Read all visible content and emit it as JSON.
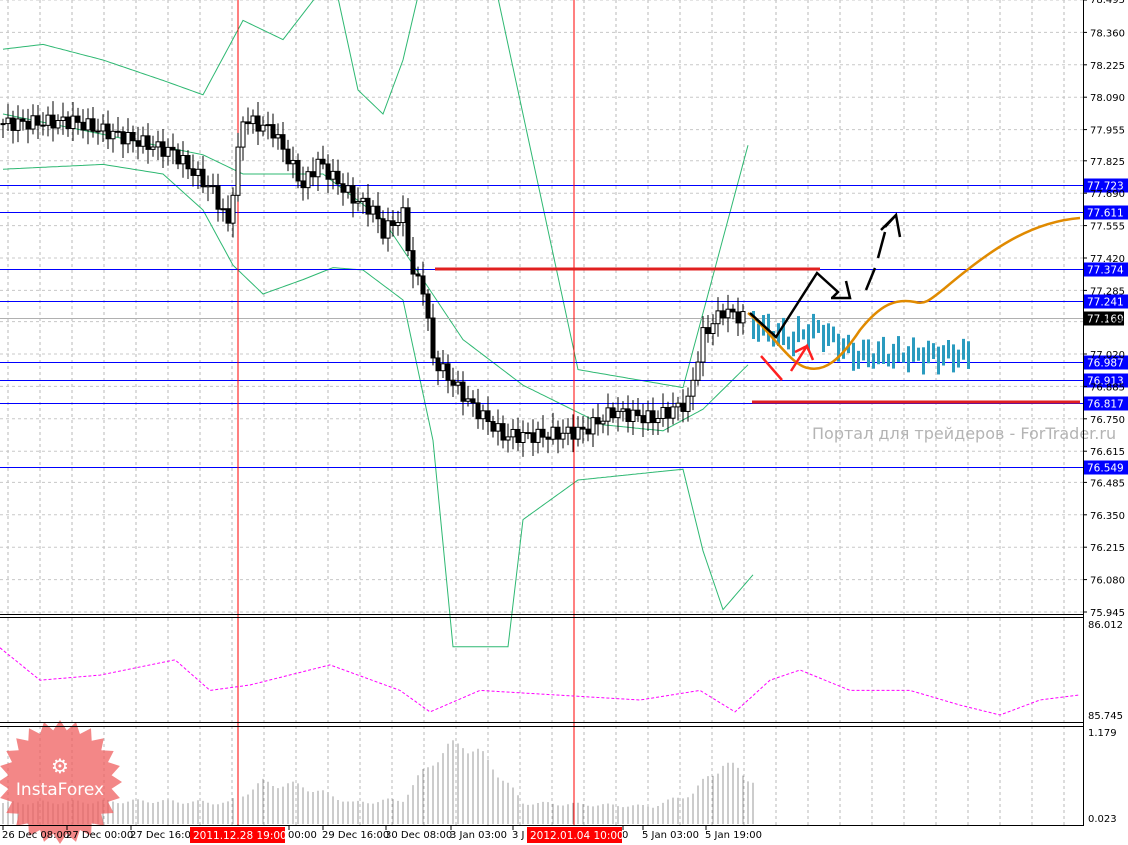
{
  "chart_data": {
    "type": "candlestick",
    "title": "",
    "price_axis": {
      "min": 75.945,
      "max": 78.495,
      "ticks": [
        "78.495",
        "78.360",
        "78.225",
        "78.090",
        "77.955",
        "77.825",
        "77.690",
        "77.555",
        "77.420",
        "77.285",
        "77.155",
        "77.020",
        "76.885",
        "76.750",
        "76.615",
        "76.485",
        "76.350",
        "76.215",
        "76.080",
        "75.945"
      ]
    },
    "time_labels": [
      "26 Dec 08:00",
      "27 Dec 00:00",
      "27 Dec 16:00",
      "00:00",
      "29 Dec 16:00",
      "30 Dec 08:00",
      "3 Jan 03:00",
      "3 J",
      "0",
      "5 Jan 03:00",
      "5 Jan 19:00"
    ],
    "highlighted_times": [
      "2011.12.28 19:00",
      "2012.01.04 10:00"
    ],
    "close_keypoints": [
      [
        0,
        77.98
      ],
      [
        14,
        77.99
      ],
      [
        34,
        77.86
      ],
      [
        42,
        77.7
      ],
      [
        45,
        77.56
      ],
      [
        48,
        78.0
      ],
      [
        54,
        77.95
      ],
      [
        60,
        77.72
      ],
      [
        63,
        77.82
      ],
      [
        70,
        77.67
      ],
      [
        74,
        77.62
      ],
      [
        76,
        77.53
      ],
      [
        80,
        77.6
      ],
      [
        82,
        77.35
      ],
      [
        84,
        77.3
      ],
      [
        86,
        77.0
      ],
      [
        88,
        76.95
      ],
      [
        94,
        76.8
      ],
      [
        100,
        76.68
      ],
      [
        108,
        76.68
      ],
      [
        116,
        76.7
      ],
      [
        122,
        76.78
      ],
      [
        130,
        76.75
      ],
      [
        137,
        76.82
      ],
      [
        140,
        77.1
      ],
      [
        144,
        77.2
      ],
      [
        148,
        77.17
      ]
    ],
    "bollinger": {
      "upper": [
        [
          0,
          78.29
        ],
        [
          8,
          78.31
        ],
        [
          20,
          78.245
        ],
        [
          32,
          78.16
        ],
        [
          40,
          78.1
        ],
        [
          48,
          78.41
        ],
        [
          56,
          78.33
        ],
        [
          66,
          78.6
        ],
        [
          71,
          78.12
        ],
        [
          76,
          78.02
        ],
        [
          80,
          78.245
        ],
        [
          84,
          78.6
        ],
        [
          98,
          78.6
        ],
        [
          115,
          76.955
        ],
        [
          136,
          76.88
        ],
        [
          149,
          77.89
        ]
      ],
      "middle": [
        [
          0,
          78.02
        ],
        [
          40,
          77.85
        ],
        [
          48,
          77.77
        ],
        [
          64,
          77.77
        ],
        [
          76,
          77.58
        ],
        [
          84,
          77.33
        ],
        [
          92,
          77.08
        ],
        [
          104,
          76.89
        ],
        [
          120,
          76.725
        ],
        [
          132,
          76.7
        ],
        [
          140,
          76.79
        ],
        [
          149,
          76.975
        ]
      ],
      "lower": [
        [
          0,
          77.79
        ],
        [
          20,
          77.81
        ],
        [
          32,
          77.77
        ],
        [
          40,
          77.62
        ],
        [
          46,
          77.39
        ],
        [
          52,
          77.27
        ],
        [
          60,
          77.33
        ],
        [
          66,
          77.38
        ],
        [
          72,
          77.37
        ],
        [
          80,
          77.245
        ],
        [
          86,
          76.66
        ],
        [
          90,
          75.8
        ],
        [
          101,
          75.8
        ],
        [
          104,
          76.33
        ],
        [
          115,
          76.495
        ],
        [
          136,
          76.54
        ],
        [
          140,
          76.2
        ],
        [
          144,
          75.955
        ],
        [
          150,
          76.1
        ]
      ]
    },
    "levels": [
      {
        "label": "77.723",
        "price": 77.723,
        "color": "#0000ff"
      },
      {
        "label": "77.611",
        "price": 77.611,
        "color": "#0000ff"
      },
      {
        "label": "77.374",
        "price": 77.374,
        "color": "#0000ff"
      },
      {
        "label": "77.241",
        "price": 77.241,
        "color": "#0000ff"
      },
      {
        "label": "76.987",
        "price": 76.987,
        "color": "#0000ff"
      },
      {
        "label": "76.913",
        "price": 76.913,
        "color": "#0000ff"
      },
      {
        "label": "76.817",
        "price": 76.817,
        "color": "#0000ff"
      },
      {
        "label": "76.549",
        "price": 76.549,
        "color": "#0000ff"
      }
    ],
    "current_price": {
      "label": "77.169",
      "price": 77.169
    },
    "oscillator": {
      "min": 85.745,
      "max": 86.012,
      "labels": [
        "86.012",
        "85.745"
      ],
      "color": "#ff00ff",
      "points": [
        [
          0,
          85.945
        ],
        [
          8,
          85.85
        ],
        [
          20,
          85.865
        ],
        [
          35,
          85.91
        ],
        [
          42,
          85.82
        ],
        [
          50,
          85.836
        ],
        [
          66,
          85.895
        ],
        [
          80,
          85.82
        ],
        [
          86,
          85.757
        ],
        [
          96,
          85.82
        ],
        [
          128,
          85.792
        ],
        [
          140,
          85.82
        ],
        [
          147,
          85.757
        ],
        [
          154,
          85.85
        ],
        [
          160,
          85.88
        ],
        [
          170,
          85.82
        ],
        [
          182,
          85.82
        ],
        [
          192,
          85.777
        ],
        [
          200,
          85.748
        ],
        [
          208,
          85.792
        ],
        [
          216,
          85.807
        ]
      ]
    },
    "volume": {
      "min": 0.023,
      "max": 1.179,
      "labels": [
        "1.179",
        "0.023"
      ],
      "keypoints": [
        [
          0,
          0.25
        ],
        [
          30,
          0.28
        ],
        [
          45,
          0.25
        ],
        [
          52,
          0.55
        ],
        [
          60,
          0.5
        ],
        [
          70,
          0.25
        ],
        [
          80,
          0.3
        ],
        [
          86,
          0.9
        ],
        [
          92,
          1.17
        ],
        [
          98,
          0.8
        ],
        [
          104,
          0.25
        ],
        [
          130,
          0.2
        ],
        [
          138,
          0.4
        ],
        [
          144,
          0.85
        ],
        [
          150,
          0.6
        ]
      ]
    }
  },
  "watermark": "Портал для трейдеров - ForTrader.ru",
  "logo": "InstaForex",
  "colors": {
    "bullish_bear": "#000000",
    "bands": "#2eb872",
    "levels": "#0000ff",
    "marks": "#ff0000",
    "forecast": "#e08a00",
    "forecast_bars": "#2a9bbf"
  }
}
